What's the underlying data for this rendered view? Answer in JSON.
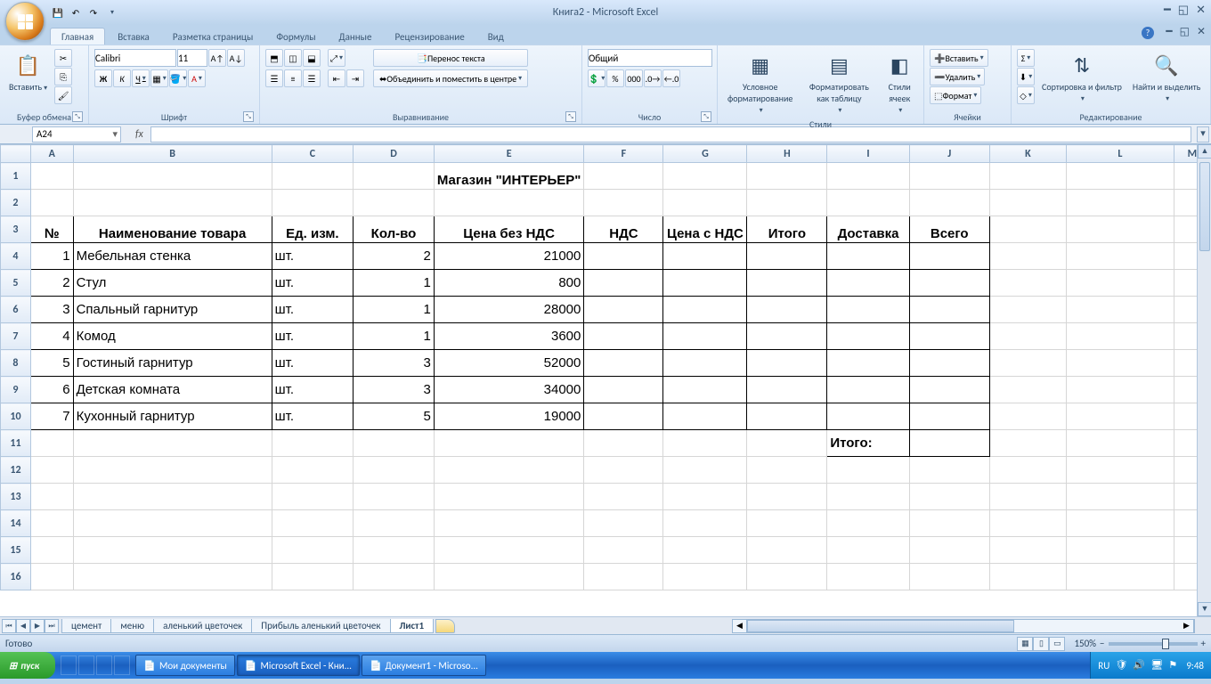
{
  "title": "Книга2 - Microsoft Excel",
  "tabs": [
    "Главная",
    "Вставка",
    "Разметка страницы",
    "Формулы",
    "Данные",
    "Рецензирование",
    "Вид"
  ],
  "active_tab": 0,
  "ribbon": {
    "clipboard": {
      "paste": "Вставить",
      "label": "Буфер обмена"
    },
    "font": {
      "name": "Calibri",
      "size": "11",
      "label": "Шрифт",
      "bold": "Ж",
      "italic": "К",
      "underline": "Ч"
    },
    "alignment": {
      "wrap": "Перенос текста",
      "merge": "Объединить и поместить в центре",
      "label": "Выравнивание"
    },
    "number": {
      "format": "Общий",
      "label": "Число"
    },
    "styles": {
      "cond": "Условное форматирование",
      "table": "Форматировать как таблицу",
      "cell": "Стили ячеек",
      "label": "Стили"
    },
    "cells": {
      "insert": "Вставить",
      "delete": "Удалить",
      "format": "Формат",
      "label": "Ячейки"
    },
    "editing": {
      "sort": "Сортировка и фильтр",
      "find": "Найти и выделить",
      "label": "Редактирование"
    }
  },
  "namebox": "A24",
  "formula": "",
  "cols": {
    "A": 50,
    "B": 228,
    "C": 94,
    "D": 94,
    "E": 94,
    "F": 94,
    "G": 94,
    "H": 94,
    "I": 94,
    "J": 94,
    "K": 94,
    "L": 132,
    "M": 44
  },
  "rows_shown": 16,
  "sheet": {
    "title_row": "Магазин \"ИНТЕРЬЕР\"",
    "headers": [
      "№",
      "Наименование товара",
      "Ед. изм.",
      "Кол-во",
      "Цена без НДС",
      "НДС",
      "Цена с НДС",
      "Итого",
      "Доставка",
      "Всего"
    ],
    "data": [
      {
        "n": 1,
        "name": "Мебельная стенка",
        "unit": "шт.",
        "qty": 2,
        "price": 21000
      },
      {
        "n": 2,
        "name": "Стул",
        "unit": "шт.",
        "qty": 1,
        "price": 800
      },
      {
        "n": 3,
        "name": "Спальный гарнитур",
        "unit": "шт.",
        "qty": 1,
        "price": 28000
      },
      {
        "n": 4,
        "name": "Комод",
        "unit": "шт.",
        "qty": 1,
        "price": 3600
      },
      {
        "n": 5,
        "name": "Гостиный гарнитур",
        "unit": "шт.",
        "qty": 3,
        "price": 52000
      },
      {
        "n": 6,
        "name": "Детская комната",
        "unit": "шт.",
        "qty": 3,
        "price": 34000
      },
      {
        "n": 7,
        "name": "Кухонный гарнитур",
        "unit": "шт.",
        "qty": 5,
        "price": 19000
      }
    ],
    "total_label": "Итого:"
  },
  "sheet_tabs": [
    "цемент",
    "меню",
    "аленький цветочек",
    "Прибыль аленький цветочек",
    "Лист1"
  ],
  "active_sheet": 4,
  "status": "Готово",
  "zoom": "150%",
  "taskbar": {
    "start": "пуск",
    "items": [
      "Мои документы",
      "Microsoft Excel - Кни...",
      "Документ1 - Microso..."
    ],
    "active_item": 1,
    "lang": "RU",
    "clock": "9:48"
  }
}
